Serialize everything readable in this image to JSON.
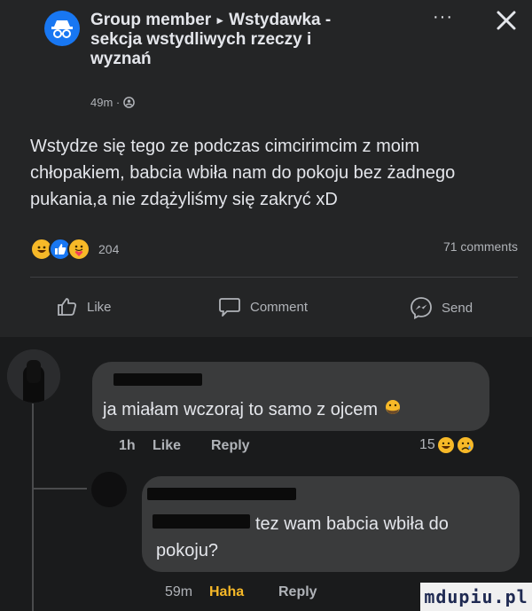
{
  "post": {
    "header_line1_a": "Group member",
    "header_line1_b": "Wstydawka -",
    "header_line2": "sekcja wstydliwych rzeczy i",
    "header_line3": "wyznań",
    "time": "49m ·",
    "more": "···",
    "body": "Wstydze się tego ze podczas cimcirimcim z moim chłopakiem, babcia wbiła nam do pokoju bez żadnego pukania,a nie zdążyliśmy się zakryć xD",
    "reactions_count": "204",
    "comments_count": "71 comments",
    "actions": {
      "like": "Like",
      "comment": "Comment",
      "send": "Send"
    }
  },
  "comments": [
    {
      "text": "ja miałam wczoraj to samo z ojcem",
      "time": "1h",
      "like": "Like",
      "reply": "Reply",
      "reactions_count": "15"
    },
    {
      "text_line1": "tez wam babcia wbiła do",
      "text_line2": "pokoju?",
      "time": "59m",
      "haha": "Haha",
      "reply": "Reply"
    }
  ],
  "watermark": "mdupiu.pl",
  "colors": {
    "accent": "#1877f2",
    "haha": "#f7b928",
    "background": "#242526"
  }
}
